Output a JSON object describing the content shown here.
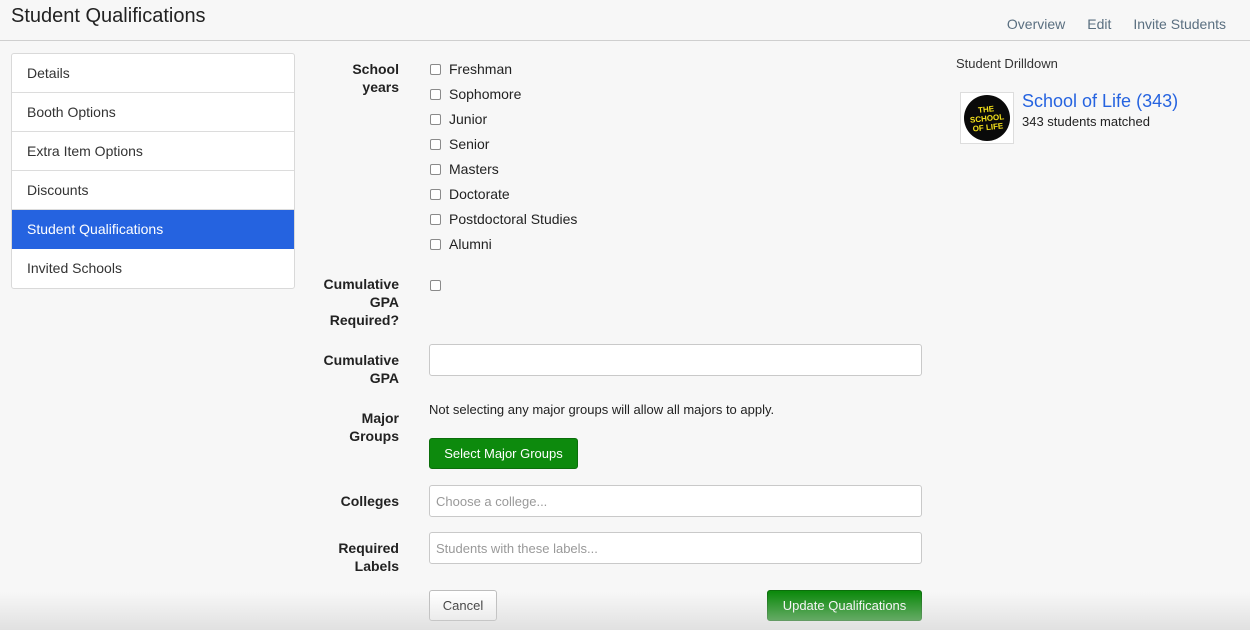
{
  "header": {
    "title": "Student Qualifications",
    "nav": [
      "Overview",
      "Edit",
      "Invite Students"
    ]
  },
  "sidebar": {
    "items": [
      {
        "label": "Details"
      },
      {
        "label": "Booth Options"
      },
      {
        "label": "Extra Item Options"
      },
      {
        "label": "Discounts"
      },
      {
        "label": "Student Qualifications",
        "active": true
      },
      {
        "label": "Invited Schools"
      }
    ]
  },
  "form": {
    "school_years_label": "School years",
    "school_years": [
      {
        "label": "Freshman",
        "checked": false
      },
      {
        "label": "Sophomore",
        "checked": false
      },
      {
        "label": "Junior",
        "checked": false
      },
      {
        "label": "Senior",
        "checked": false
      },
      {
        "label": "Masters",
        "checked": false
      },
      {
        "label": "Doctorate",
        "checked": false
      },
      {
        "label": "Postdoctoral Studies",
        "checked": false
      },
      {
        "label": "Alumni",
        "checked": false
      }
    ],
    "gpa_required_label": "Cumulative GPA Required?",
    "gpa_required_checked": false,
    "gpa_label": "Cumulative GPA",
    "gpa_value": "",
    "major_groups_label": "Major Groups",
    "major_groups_help": "Not selecting any major groups will allow all majors to apply.",
    "select_major_groups_button": "Select Major Groups",
    "colleges_label": "Colleges",
    "colleges_placeholder": "Choose a college...",
    "labels_label": "Required Labels",
    "labels_placeholder": "Students with these labels...",
    "cancel_button": "Cancel",
    "update_button": "Update Qualifications"
  },
  "drilldown": {
    "title": "Student Drilldown",
    "school_name": "School of Life (343)",
    "matched": "343 students matched",
    "logo_text": [
      "THE",
      "SCHOOL",
      "OF LIFE"
    ],
    "logo_text_color": "#f5e21a"
  },
  "colors": {
    "accent": "#2563e0",
    "success": "#0d8a0d"
  }
}
